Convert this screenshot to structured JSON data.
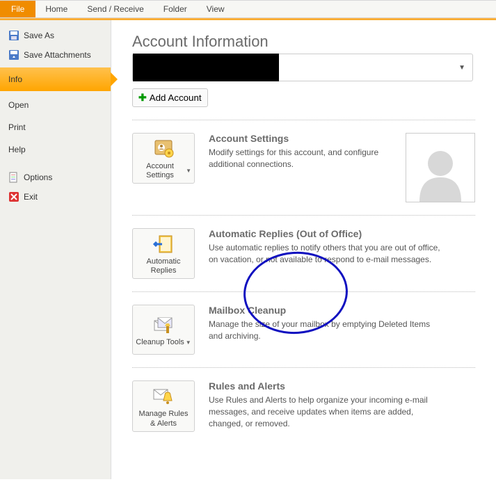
{
  "ribbon": {
    "file": "File",
    "home": "Home",
    "send_receive": "Send / Receive",
    "folder": "Folder",
    "view": "View"
  },
  "sidebar": {
    "save_as": "Save As",
    "save_attachments": "Save Attachments",
    "info": "Info",
    "open": "Open",
    "print": "Print",
    "help": "Help",
    "options": "Options",
    "exit": "Exit"
  },
  "page": {
    "title": "Account Information",
    "add_account": "Add Account"
  },
  "sec_acct": {
    "btn": "Account Settings",
    "title": "Account Settings",
    "desc": "Modify settings for this account, and configure additional connections."
  },
  "sec_auto": {
    "btn": "Automatic Replies",
    "title": "Automatic Replies (Out of Office)",
    "desc": "Use automatic replies to notify others that you are out of office, on vacation, or not available to respond to e-mail messages."
  },
  "sec_clean": {
    "btn": "Cleanup Tools",
    "title": "Mailbox Cleanup",
    "desc": "Manage the size of your mailbox by emptying Deleted Items and archiving."
  },
  "sec_rules": {
    "btn": "Manage Rules & Alerts",
    "title": "Rules and Alerts",
    "desc": "Use Rules and Alerts to help organize your incoming e-mail messages, and receive updates when items are added, changed, or removed."
  }
}
